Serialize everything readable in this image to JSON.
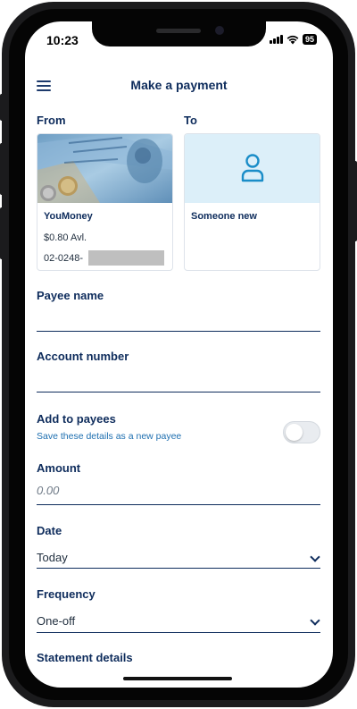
{
  "status_bar": {
    "time": "10:23",
    "battery": "95"
  },
  "header": {
    "title": "Make a payment"
  },
  "from": {
    "label": "From",
    "account_name": "YouMoney",
    "balance": "$0.80 Avl.",
    "account_number_prefix": "02-0248-"
  },
  "to": {
    "label": "To",
    "option_label": "Someone new"
  },
  "payee_name": {
    "label": "Payee name",
    "value": ""
  },
  "account_number": {
    "label": "Account number",
    "value": ""
  },
  "add_to_payees": {
    "label": "Add to payees",
    "subtitle": "Save these details as a new payee",
    "enabled": false
  },
  "amount": {
    "label": "Amount",
    "placeholder": "0.00"
  },
  "date": {
    "label": "Date",
    "value": "Today"
  },
  "frequency": {
    "label": "Frequency",
    "value": "One-off"
  },
  "statement_details": {
    "label": "Statement details"
  },
  "colors": {
    "navy": "#0e2c5c",
    "accent_blue": "#1a8dc8",
    "link_blue": "#1e6fb0",
    "to_card_bg": "#dceff9"
  },
  "icons": [
    "menu-icon",
    "person-icon",
    "chevron-down-icon",
    "wifi-icon",
    "signal-icon",
    "battery-icon"
  ]
}
